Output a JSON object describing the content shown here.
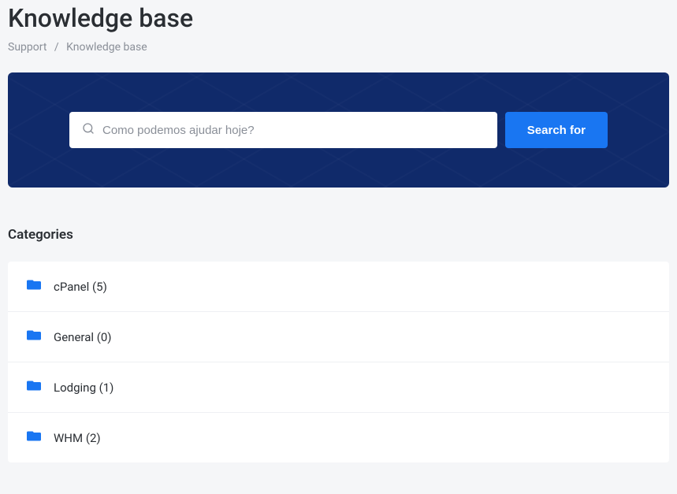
{
  "header": {
    "title": "Knowledge base"
  },
  "breadcrumb": {
    "items": [
      "Support",
      "Knowledge base"
    ]
  },
  "search": {
    "placeholder": "Como podemos ajudar hoje?",
    "button_label": "Search for"
  },
  "categories": {
    "section_title": "Categories",
    "items": [
      {
        "label": "cPanel (5)"
      },
      {
        "label": "General (0)"
      },
      {
        "label": "Lodging (1)"
      },
      {
        "label": "WHM (2)"
      }
    ]
  }
}
